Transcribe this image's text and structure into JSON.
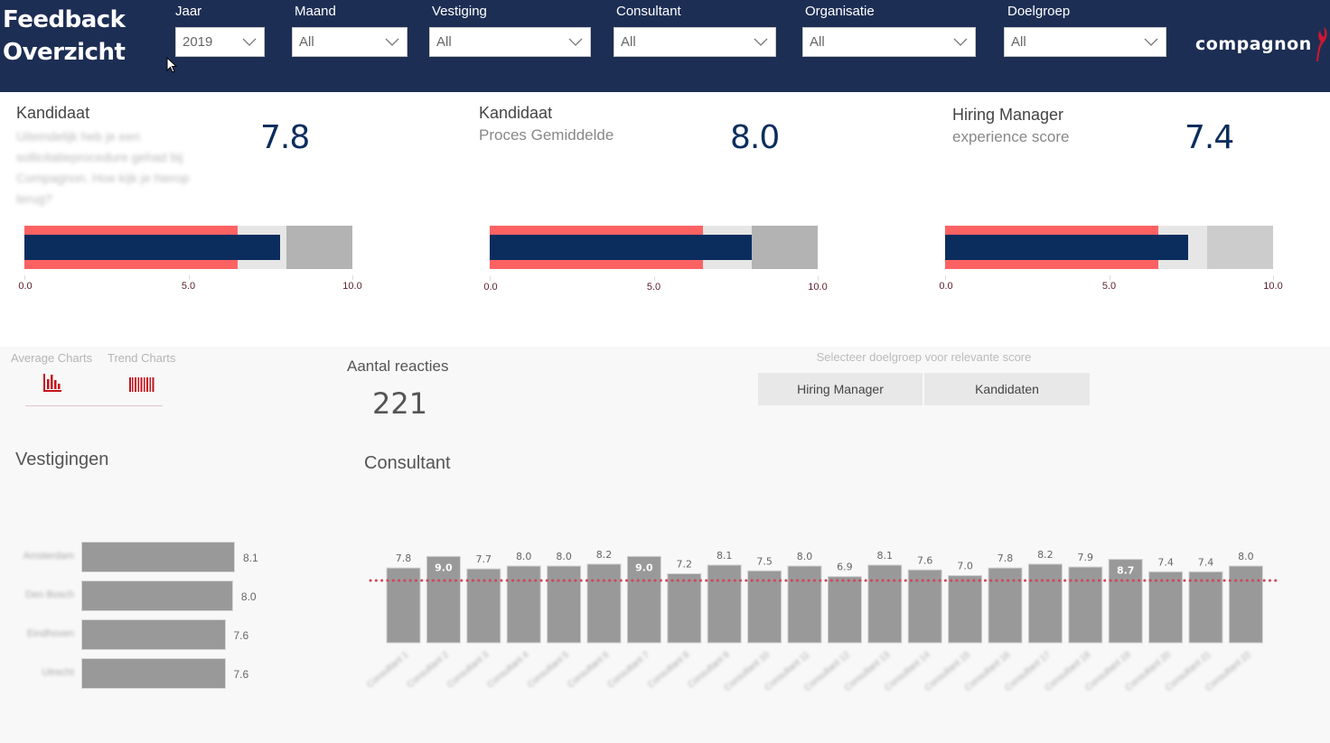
{
  "header": {
    "title_line1": "Feedback",
    "title_line2": "Overzicht",
    "filters": [
      {
        "label": "Jaar",
        "value": "2019"
      },
      {
        "label": "Maand",
        "value": "All"
      },
      {
        "label": "Vestiging",
        "value": "All"
      },
      {
        "label": "Consultant",
        "value": "All"
      },
      {
        "label": "Organisatie",
        "value": "All"
      },
      {
        "label": "Doelgroep",
        "value": "All"
      }
    ],
    "logo_text": "compagnon",
    "colors": {
      "header_bg": "#1d2e54",
      "logo_accent": "#d0172f"
    }
  },
  "kpis": [
    {
      "title": "Kandidaat",
      "subtitle": "Uiteindelijk heb je een sollicitatieprocedure gehad bij Compagnon. Hoe kijk je hierop terug?",
      "subtitle_blurred": true,
      "value": "7.8",
      "bullet": {
        "measure": 7.8,
        "red_band_end": 6.5,
        "light_band_end": 8.0,
        "max": 10.0
      },
      "axis_ticks": [
        "0.0",
        "5.0",
        "10.0"
      ]
    },
    {
      "title": "Kandidaat",
      "subtitle": "Proces Gemiddelde",
      "subtitle_blurred": false,
      "value": "8.0",
      "bullet": {
        "measure": 8.0,
        "red_band_end": 6.5,
        "light_band_end": 8.0,
        "max": 10.0
      },
      "axis_ticks": [
        "0.0",
        "5.0",
        "10.0"
      ]
    },
    {
      "title": "Hiring Manager",
      "subtitle": "experience score",
      "subtitle_blurred": false,
      "value": "7.4",
      "bullet": {
        "measure": 7.4,
        "red_band_end": 6.5,
        "light_band_end": 8.0,
        "max": 10.0
      },
      "axis_ticks": [
        "0.0",
        "5.0",
        "10.0"
      ]
    }
  ],
  "bullet_colors": {
    "red_band": "#fd6262",
    "light_band": "#e6e6e6",
    "gray_band": "#b3b3b3",
    "measure": "#0b2d5e"
  },
  "nav": {
    "average_label": "Average Charts",
    "trend_label": "Trend Charts",
    "average_icon": "bar-chart-icon",
    "trend_icon": "barcode-trend-icon"
  },
  "reacties": {
    "label": "Aantal reacties",
    "value": "221"
  },
  "doelgroep_selector": {
    "prompt": "Selecteer doelgroep voor relevante score",
    "options": [
      "Hiring Manager",
      "Kandidaten"
    ]
  },
  "vestigingen": {
    "title": "Vestigingen",
    "chart_data": {
      "type": "bar",
      "orientation": "horizontal",
      "categories": [
        "Amsterdam",
        "Den Bosch",
        "Eindhoven",
        "Utrecht"
      ],
      "labels_blurred": true,
      "values": [
        8.1,
        8.0,
        7.6,
        7.6
      ],
      "xlim": [
        0,
        10
      ]
    }
  },
  "consultant": {
    "title": "Consultant",
    "chart_data": {
      "type": "bar",
      "categories": [
        "Consultant 1",
        "Consultant 2",
        "Consultant 3",
        "Consultant 4",
        "Consultant 5",
        "Consultant 6",
        "Consultant 7",
        "Consultant 8",
        "Consultant 9",
        "Consultant 10",
        "Consultant 11",
        "Consultant 12",
        "Consultant 13",
        "Consultant 14",
        "Consultant 15",
        "Consultant 16",
        "Consultant 17",
        "Consultant 18",
        "Consultant 19",
        "Consultant 20",
        "Consultant 21",
        "Consultant 22"
      ],
      "labels_blurred": true,
      "values": [
        7.8,
        9.0,
        7.7,
        8.0,
        8.0,
        8.2,
        9.0,
        7.2,
        8.1,
        7.5,
        8.0,
        6.9,
        8.1,
        7.6,
        7.0,
        7.8,
        8.2,
        7.9,
        8.7,
        7.4,
        7.4,
        8.0
      ],
      "reference_line": {
        "value": 6.5,
        "style": "dotted",
        "color": "#d0465a"
      },
      "ylim": [
        0,
        10
      ],
      "bar_color": "#999999"
    }
  }
}
